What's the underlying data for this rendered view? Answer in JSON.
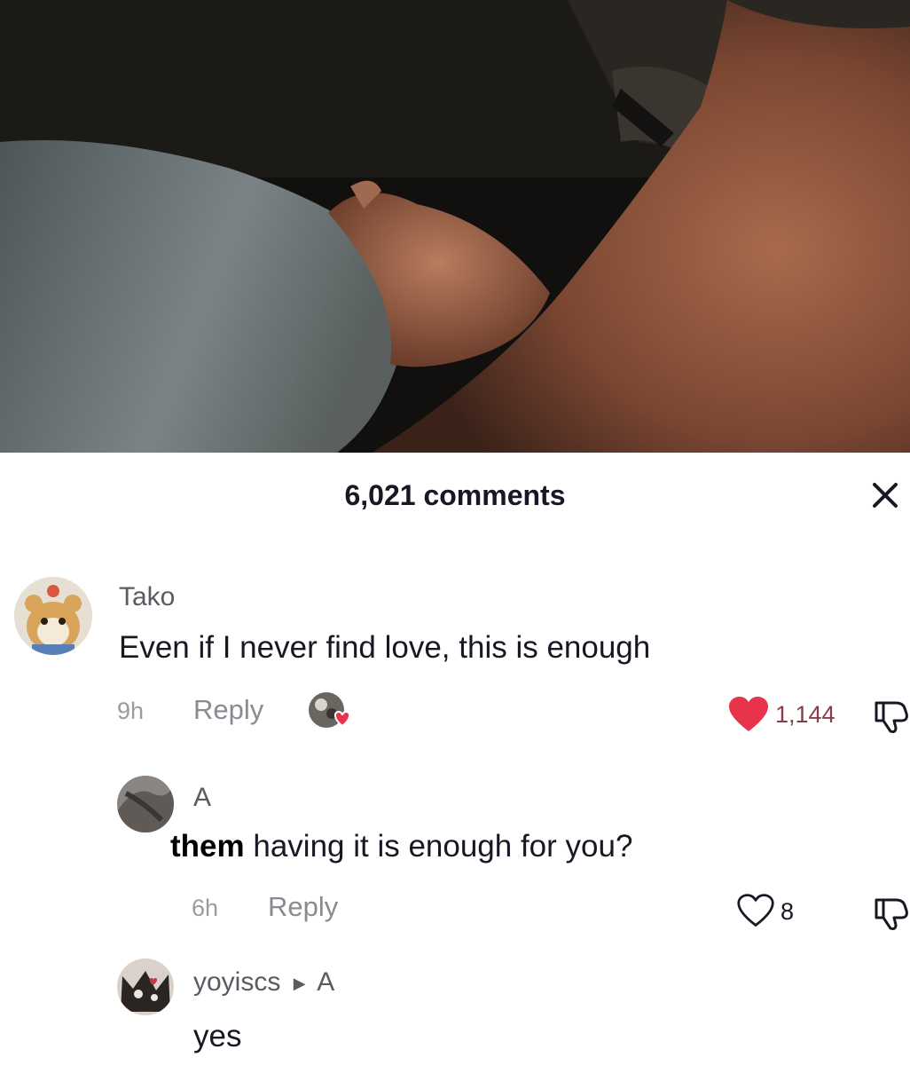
{
  "sheet": {
    "comment_count": "6,021 comments"
  },
  "comments": [
    {
      "username": "Tako",
      "text": "Even if I never find love, this is enough",
      "time": "9h",
      "reply_label": "Reply",
      "likes": "1,144",
      "liked": true
    },
    {
      "username": "A",
      "mention": "them",
      "text": "having it is enough for you?",
      "time": "6h",
      "reply_label": "Reply",
      "likes": "8",
      "liked": false
    },
    {
      "username": "yoyiscs",
      "reply_to": "A",
      "text": "yes"
    }
  ],
  "icons": [
    "close-icon",
    "heart-filled-icon",
    "heart-outline-icon",
    "dislike-icon",
    "creator-liked-avatar-icon",
    "reply-arrow-icon"
  ],
  "colors": {
    "heart": "#e8334a",
    "likes_text": "#8c3a4a",
    "muted": "#8a8a92"
  }
}
